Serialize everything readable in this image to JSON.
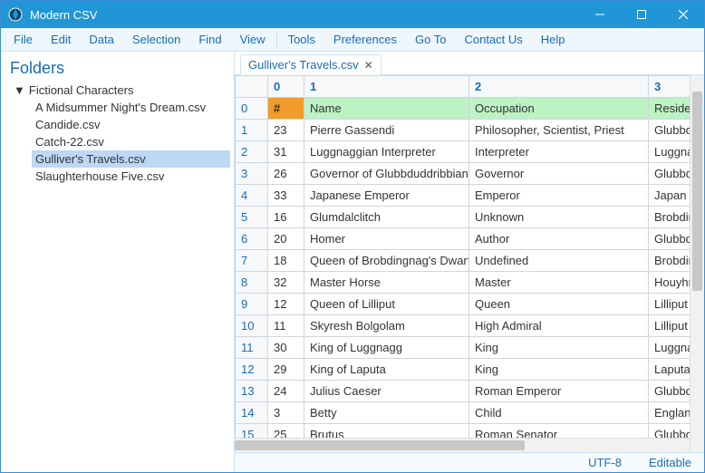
{
  "window": {
    "title": "Modern CSV"
  },
  "menus": {
    "left": [
      "File",
      "Edit",
      "Data",
      "Selection",
      "Find",
      "View"
    ],
    "right": [
      "Tools",
      "Preferences",
      "Go To",
      "Contact Us",
      "Help"
    ]
  },
  "sidebar": {
    "title": "Folders",
    "root": "Fictional Characters",
    "files": [
      "A Midsummer Night's Dream.csv",
      "Candide.csv",
      "Catch-22.csv",
      "Gulliver's Travels.csv",
      "Slaughterhouse Five.csv"
    ],
    "selected_index": 3
  },
  "tabs": [
    {
      "label": "Gulliver's Travels.csv"
    }
  ],
  "grid": {
    "col_headers": [
      "0",
      "1",
      "2",
      "3"
    ],
    "header_row": [
      "#",
      "Name",
      "Occupation",
      "Residence"
    ],
    "rows": [
      [
        "23",
        "Pierre Gassendi",
        "Philosopher, Scientist, Priest",
        "Glubbdubdrib"
      ],
      [
        "31",
        "Luggnaggian Interpreter",
        "Interpreter",
        "Luggnagg"
      ],
      [
        "26",
        "Governor of Glubbduddribbian",
        "Governor",
        "Glubbdubdrib"
      ],
      [
        "33",
        "Japanese Emperor",
        "Emperor",
        "Japan"
      ],
      [
        "16",
        "Glumdalclitch",
        "Unknown",
        "Brobdingnag"
      ],
      [
        "20",
        "Homer",
        "Author",
        "Glubbdubdrib"
      ],
      [
        "18",
        "Queen of Brobdingnag's Dwarf",
        "Undefined",
        "Brobdingnag"
      ],
      [
        "32",
        "Master Horse",
        "Master",
        "Houyhnhnm"
      ],
      [
        "12",
        "Queen of Lilliput",
        "Queen",
        "Lilliput"
      ],
      [
        "11",
        "Skyresh Bolgolam",
        "High Admiral",
        "Lilliput"
      ],
      [
        "30",
        "King of Luggnagg",
        "King",
        "Luggnagg"
      ],
      [
        "29",
        "King of Laputa",
        "King",
        "Laputa"
      ],
      [
        "24",
        "Julius Caeser",
        "Roman Emperor",
        "Glubbdubdrib"
      ],
      [
        "3",
        "Betty",
        "Child",
        "England"
      ],
      [
        "25",
        "Brutus",
        "Roman Senator",
        "Glubbdubdrib"
      ]
    ]
  },
  "status": {
    "encoding": "UTF-8",
    "mode": "Editable"
  }
}
